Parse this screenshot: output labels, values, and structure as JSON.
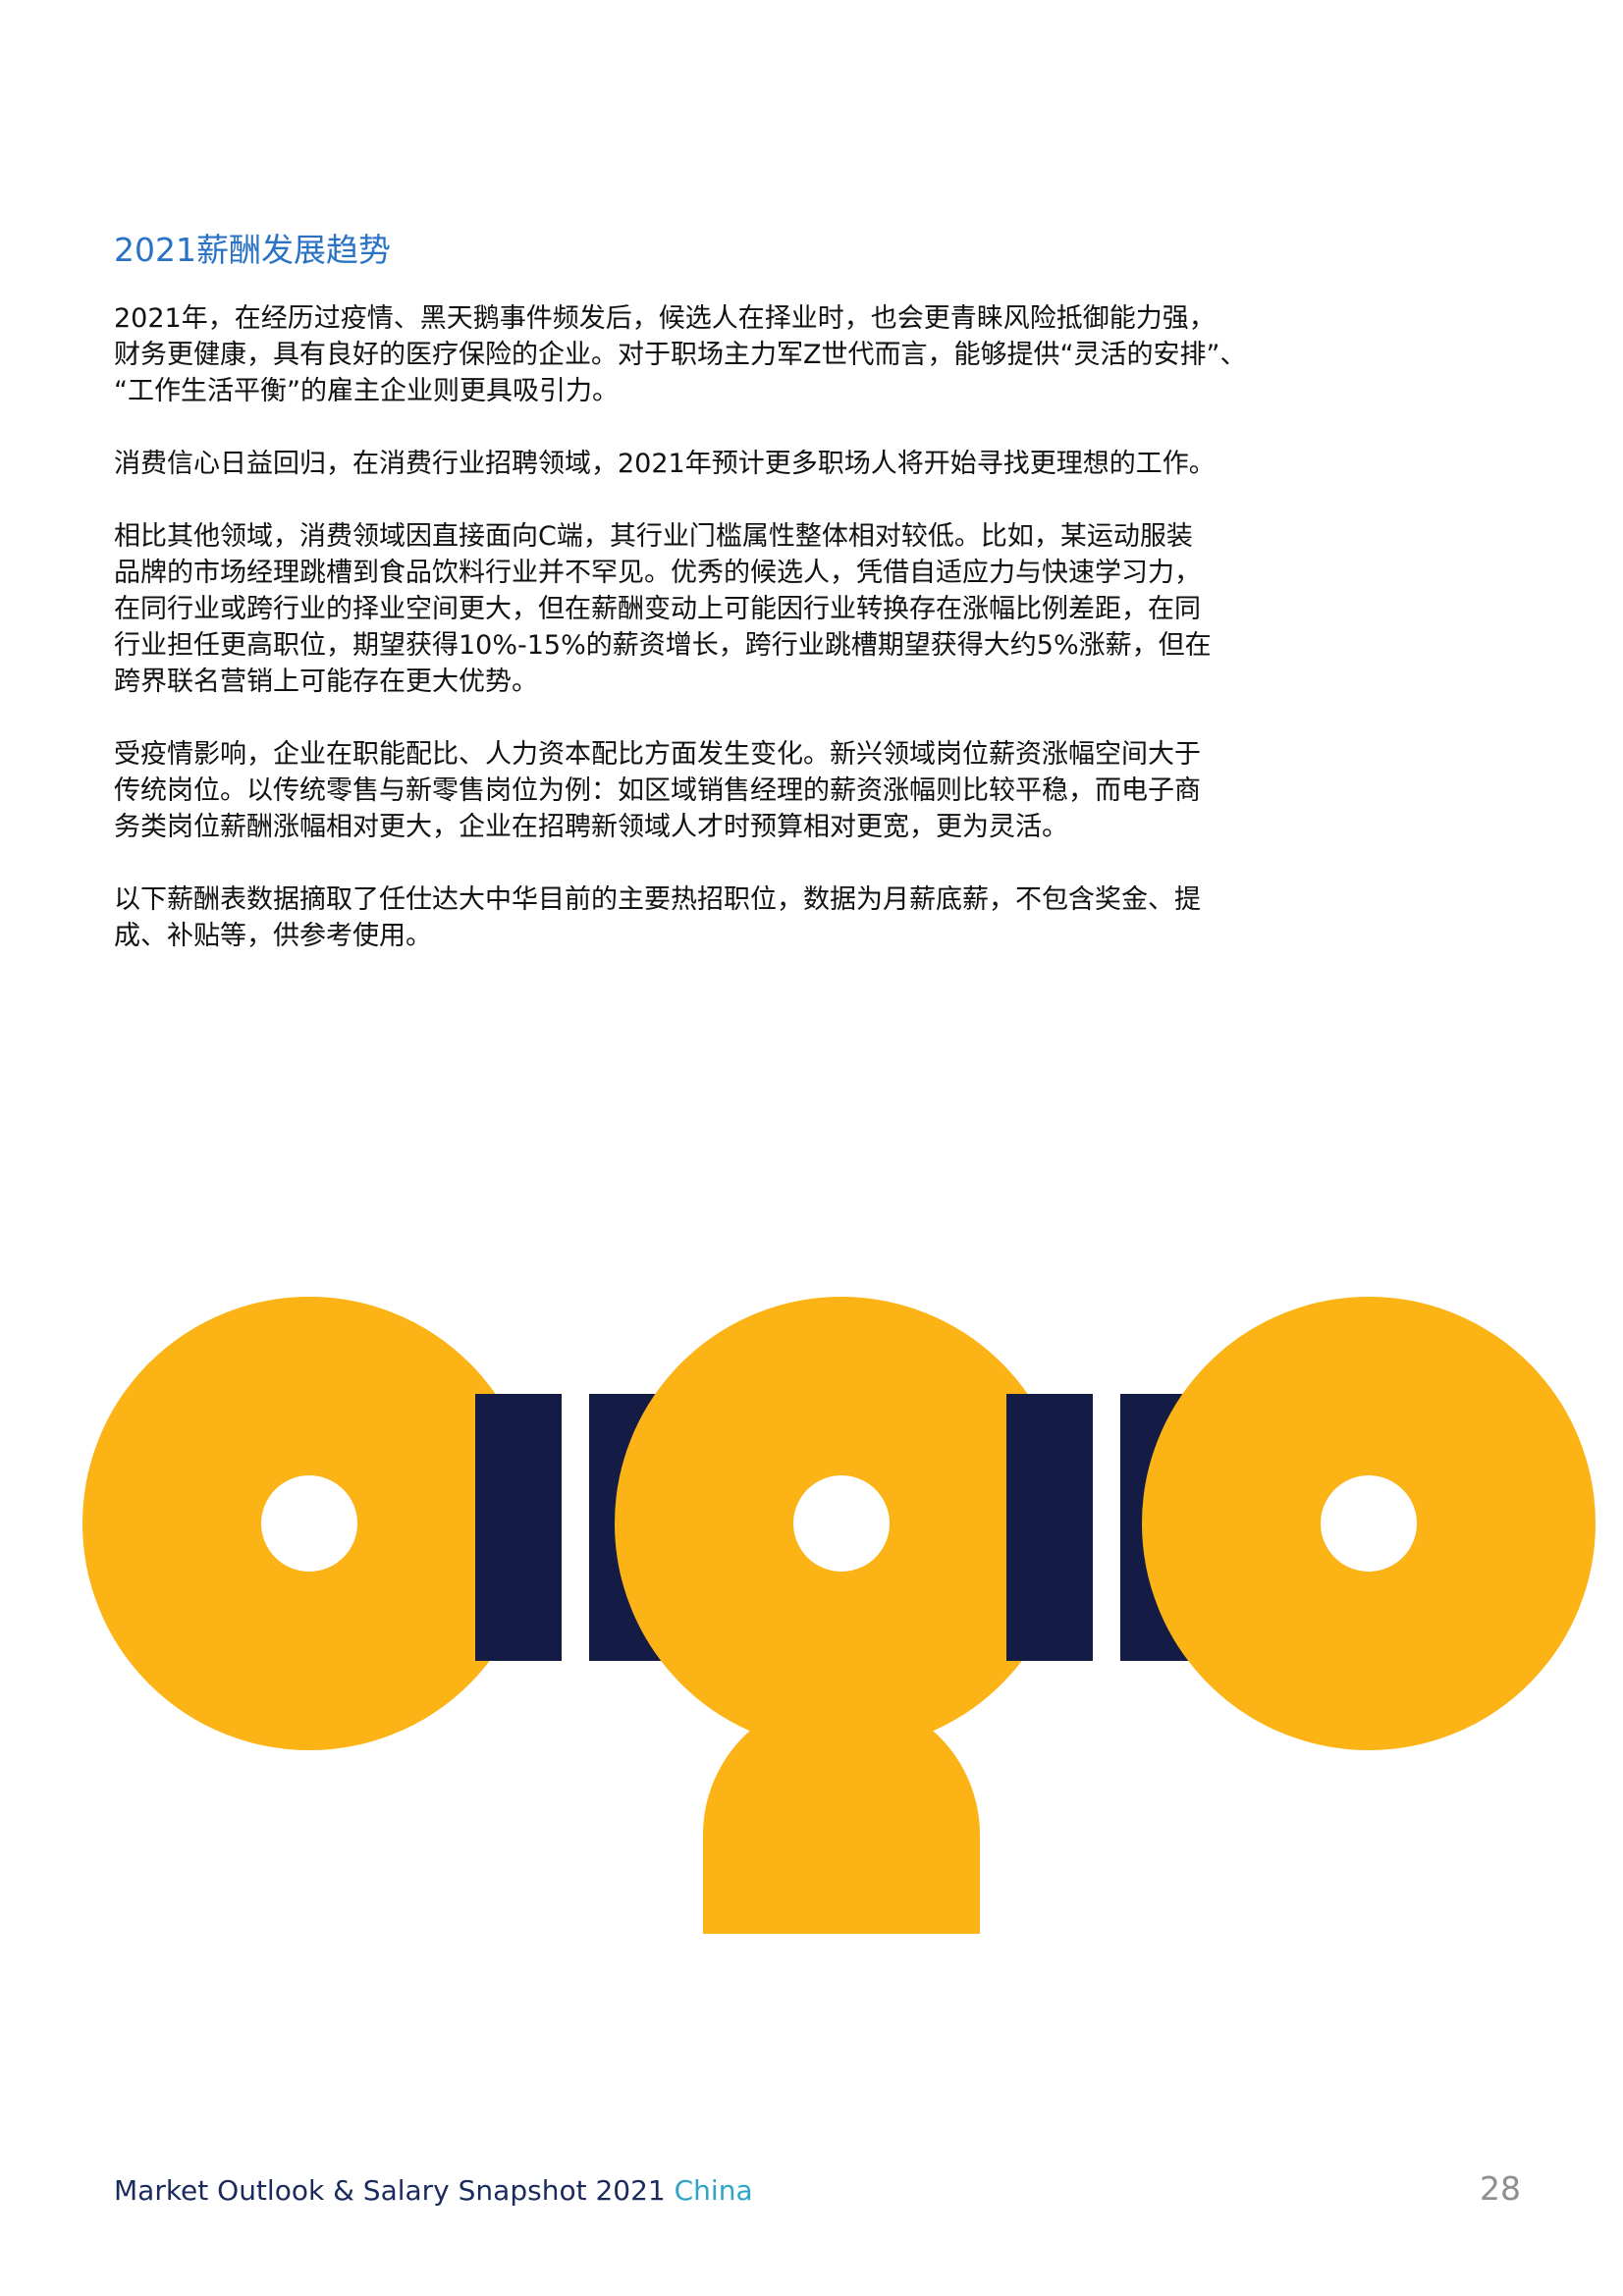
{
  "heading": "2021薪酬发展趋势",
  "paragraphs": [
    {
      "lines": [
        "2021年，在经历过疫情、黑天鹅事件频发后，候选人在择业时，也会更青睐风险抵御能力强，",
        "财务更健康，具有良好的医疗保险的企业。对于职场主力军Z世代而言，能够提供“灵活的安排”、",
        "“工作生活平衡”的雇主企业则更具吸引力。"
      ]
    },
    {
      "lines": [
        "消费信心日益回归，在消费行业招聘领域，2021年预计更多职场人将开始寻找更理想的工作。"
      ]
    },
    {
      "lines": [
        "相比其他领域，消费领域因直接面向C端，其行业门槛属性整体相对较低。比如，某运动服装",
        "品牌的市场经理跳槽到食品饮料行业并不罕见。优秀的候选人，凭借自适应力与快速学习力，",
        "在同行业或跨行业的择业空间更大，但在薪酬变动上可能因行业转换存在涨幅比例差距，在同",
        "行业担任更高职位，期望获得10%-15%的薪资增长，跨行业跳槽期望获得大约5%涨薪，但在",
        "跨界联名营销上可能存在更大优势。"
      ]
    },
    {
      "lines": [
        "受疫情影响，企业在职能配比、人力资本配比方面发生变化。新兴领域岗位薪资涨幅空间大于",
        "传统岗位。以传统零售与新零售岗位为例：如区域销售经理的薪资涨幅则比较平稳，而电子商",
        "务类岗位薪酬涨幅相对更大，企业在招聘新领域人才时预算相对更宽，更为灵活。"
      ]
    },
    {
      "lines": [
        "以下薪酬表数据摘取了任仕达大中华目前的主要热招职位，数据为月薪底薪，不包含奖金、提",
        "成、补贴等，供参考使用。"
      ]
    }
  ],
  "colors": {
    "yellow": "#fbb316",
    "navy": "#141c45",
    "heading": "#2a73c4",
    "footer_accent": "#2fa4c8"
  },
  "footer": {
    "title": "Market Outlook & Salary Snapshot 2021",
    "country": "China",
    "page": "28"
  }
}
